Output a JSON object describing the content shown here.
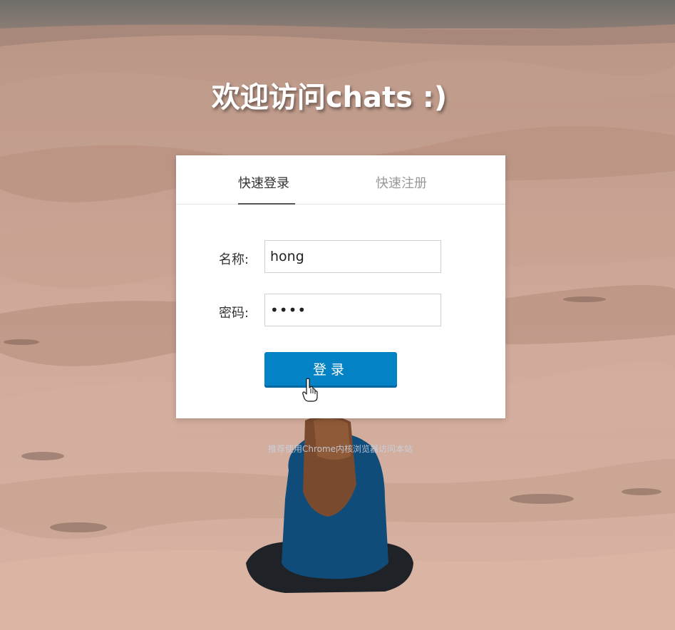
{
  "page": {
    "title": "欢迎访问chats :)",
    "footnote": "推荐使用Chrome内核浏览器访问本站"
  },
  "tabs": [
    {
      "label": "快速登录",
      "active": true
    },
    {
      "label": "快速注册",
      "active": false
    }
  ],
  "form": {
    "name_label": "名称:",
    "name_value": "hong",
    "password_label": "密码:",
    "password_value": "••••",
    "submit_label": "登录"
  },
  "colors": {
    "button": "#0383c5",
    "active_tab": "#333333",
    "inactive_tab": "#999999",
    "title": "#ffffff"
  },
  "icons": {
    "cursor": "hand-pointer-icon"
  }
}
